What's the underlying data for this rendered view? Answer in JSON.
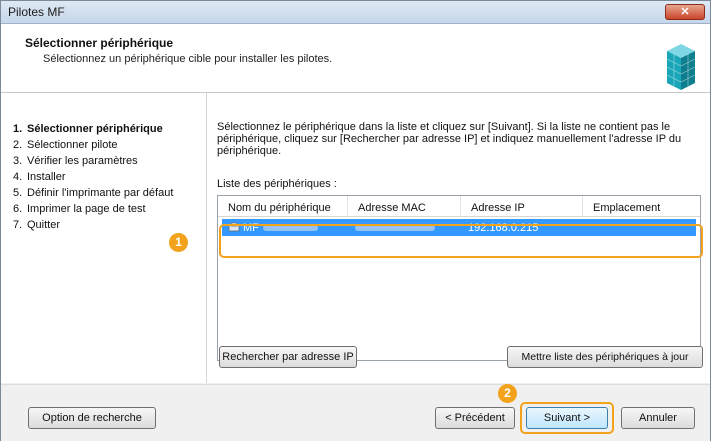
{
  "window": {
    "title": "Pilotes MF",
    "close_glyph": "✕"
  },
  "header": {
    "title": "Sélectionner périphérique",
    "subtitle": "Sélectionnez un périphérique cible pour installer les pilotes.",
    "icon": "cube-icon"
  },
  "steps": [
    {
      "num": "1.",
      "label": "Sélectionner périphérique",
      "active": true
    },
    {
      "num": "2.",
      "label": "Sélectionner pilote",
      "active": false
    },
    {
      "num": "3.",
      "label": "Vérifier les paramètres",
      "active": false
    },
    {
      "num": "4.",
      "label": "Installer",
      "active": false
    },
    {
      "num": "5.",
      "label": "Définir l'imprimante par défaut",
      "active": false
    },
    {
      "num": "6.",
      "label": "Imprimer la page de test",
      "active": false
    },
    {
      "num": "7.",
      "label": "Quitter",
      "active": false
    }
  ],
  "content": {
    "description": "Sélectionnez le périphérique dans la liste et cliquez sur [Suivant]. Si la liste ne contient pas le périphérique, cliquez sur [Rechercher par adresse IP] et indiquez manuellement l'adresse IP du périphérique.",
    "list_label": "Liste des périphériques :",
    "columns": [
      "Nom du périphérique",
      "Adresse MAC",
      "Adresse IP",
      "Emplacement"
    ],
    "rows": [
      {
        "name": "MF",
        "ip": "192.168.0.215",
        "selected": true
      }
    ],
    "search_ip_button": "Rechercher par adresse IP",
    "refresh_button": "Mettre liste des périphériques à jour"
  },
  "callouts": {
    "one": "1",
    "two": "2",
    "color": "#f2a31b"
  },
  "footer": {
    "search_option_button": "Option de recherche",
    "back_button": "< Précédent",
    "next_button": "Suivant >",
    "cancel_button": "Annuler"
  }
}
